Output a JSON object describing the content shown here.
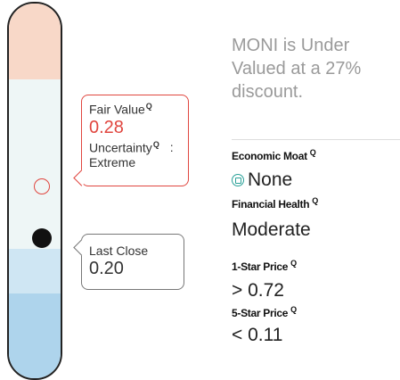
{
  "valuation": {
    "fair_value_label": "Fair Value",
    "fair_value": "0.28",
    "uncertainty_label": "Uncertainty",
    "uncertainty_sep": ":",
    "uncertainty_value": "Extreme",
    "last_close_label": "Last Close",
    "last_close": "0.20",
    "question_icon": "magnifier-q-icon",
    "q_glyph": "Q"
  },
  "summary": {
    "headline": "MONI is Under Valued at a 27% discount."
  },
  "metrics": {
    "economic_moat_label": "Economic Moat",
    "economic_moat_value": "None",
    "economic_moat_icon": "moat-icon",
    "financial_health_label": "Financial Health",
    "financial_health_value": "Moderate",
    "one_star_label": "1-Star Price",
    "one_star_value": "> 0.72",
    "five_star_label": "5-Star Price",
    "five_star_value": "< 0.11"
  },
  "colors": {
    "accent_red": "#e0463f",
    "overvalued_zone": "#f8d8c8",
    "fair_zone": "#eef6f6",
    "undervalued_zone": "#aed4ec",
    "moat_teal": "#2aa198"
  }
}
